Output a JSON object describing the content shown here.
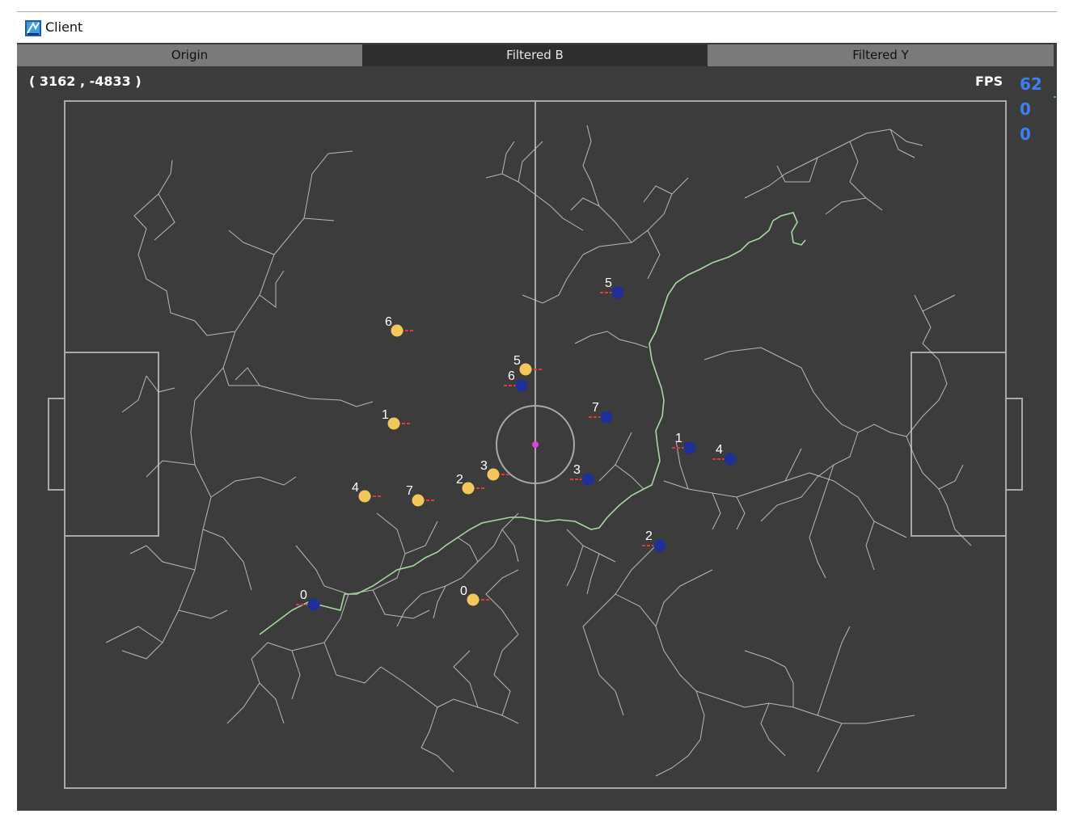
{
  "window": {
    "title": "Client",
    "icon": "app-logo-icon"
  },
  "tabs": [
    {
      "label": "Origin",
      "active": false
    },
    {
      "label": "Filtered B",
      "active": true
    },
    {
      "label": "Filtered Y",
      "active": false
    }
  ],
  "cursor_coord": "( 3162 , -4833 )",
  "fps": {
    "label": "FPS",
    "values": [
      "62",
      "0",
      "0"
    ]
  },
  "colors": {
    "background": "#3c3c3c",
    "field_lines": "#a9a9a9",
    "tree_lines": "#cfcfcf",
    "path": "#a6d9a0",
    "yellow_team": "#f2c75c",
    "blue_team": "#1f2f9a",
    "heading_marker": "#e23a3a",
    "ball": "#e040e0",
    "fps_value": "#3d7ff0"
  },
  "robots": {
    "yellow": [
      "6",
      "5",
      "1",
      "3",
      "2",
      "4",
      "7",
      "0"
    ],
    "blue": [
      "5",
      "6",
      "7",
      "3",
      "1",
      "4",
      "2",
      "0"
    ]
  }
}
